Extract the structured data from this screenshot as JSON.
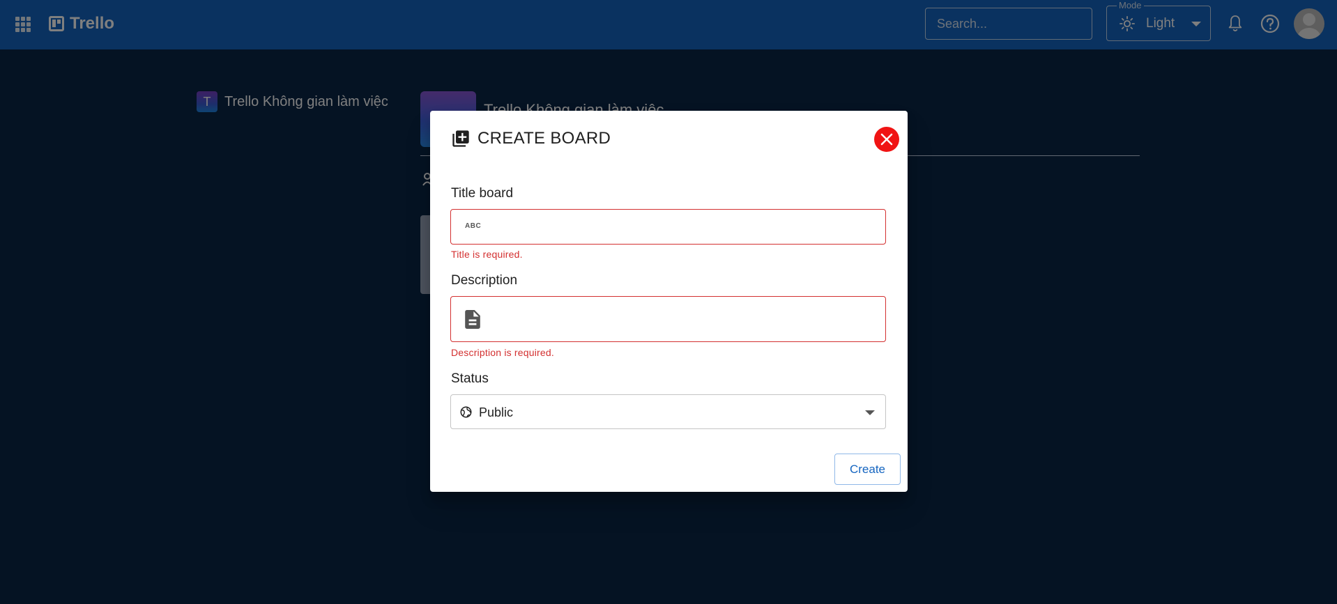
{
  "header": {
    "brand": "Trello",
    "search_placeholder": "Search...",
    "mode_label": "Mode",
    "mode_value": "Light"
  },
  "background": {
    "workspace_initial": "T",
    "workspace_name": "Trello Không gian làm việc",
    "workspace_header_title": "Trello Không gian làm việc"
  },
  "modal": {
    "title": "CREATE BOARD",
    "title_field": {
      "label": "Title board",
      "icon_text": "ABC",
      "value": "",
      "error": "Title is required."
    },
    "description_field": {
      "label": "Description",
      "value": "",
      "error": "Description is required."
    },
    "status_field": {
      "label": "Status",
      "value": "Public"
    },
    "create_label": "Create"
  },
  "colors": {
    "appbar": "#1565c0",
    "page_bg": "#0b2647",
    "error": "#d32f2f",
    "close_button": "#f01414",
    "primary_text": "#1565c0"
  }
}
